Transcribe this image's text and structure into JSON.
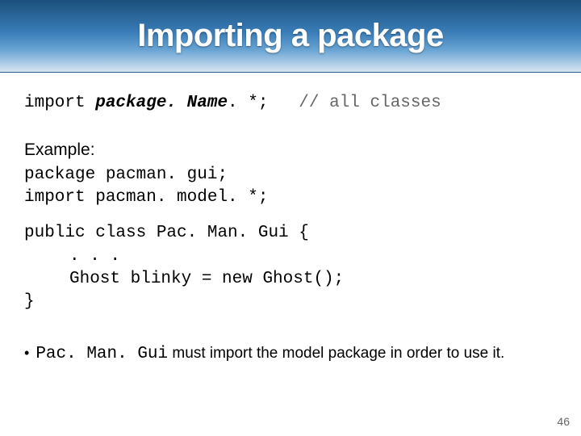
{
  "title": "Importing a package",
  "syntax": {
    "import_kw": "import ",
    "package_param": "package. Name",
    "wildcard": ". *;",
    "comment": "// all classes"
  },
  "example_label": "Example:",
  "code": {
    "l1": "package pacman. gui;",
    "l2": "import pacman. model. *;",
    "l3": "public class Pac. Man. Gui {",
    "l4": ". . .",
    "l5": "Ghost blinky = new Ghost();",
    "l6": "}"
  },
  "note": {
    "bullet": "•",
    "code_ref": "Pac. Man. Gui",
    "rest": " must import the model package in order to use it."
  },
  "slide_number": "46"
}
